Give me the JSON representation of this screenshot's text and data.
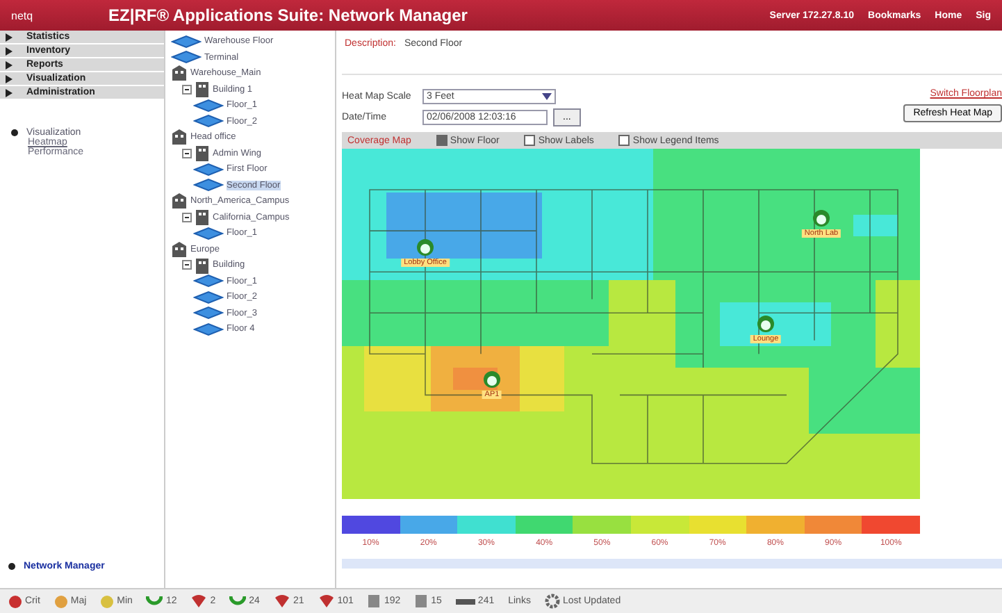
{
  "header": {
    "logo": "netq",
    "title": "EZ|RF® Applications Suite: Network Manager",
    "links": [
      "Server 172.27.8.10",
      "Bookmarks",
      "Home",
      "Sig"
    ]
  },
  "nav": {
    "menu": [
      "Statistics",
      "Inventory",
      "Reports",
      "Visualization",
      "Administration"
    ],
    "section": "Visualization",
    "sub_items": [
      {
        "label": "Heatmap",
        "selected": true
      },
      {
        "label": "Performance",
        "selected": false
      }
    ],
    "bottom_link": "Network Manager"
  },
  "tree": [
    {
      "label": "Warehouse Floor",
      "kind": "floor",
      "selected": false
    },
    {
      "label": "Terminal",
      "kind": "floor",
      "selected": false
    },
    {
      "label": "Warehouse_Main",
      "kind": "site",
      "children": [
        {
          "label": "Building 1",
          "kind": "building",
          "expanded": true,
          "children": [
            {
              "label": "Floor_1",
              "kind": "floor",
              "selected": false
            },
            {
              "label": "Floor_2",
              "kind": "floor",
              "selected": false
            }
          ]
        }
      ]
    },
    {
      "label": "Head office",
      "kind": "site",
      "children": [
        {
          "label": "Admin Wing",
          "kind": "building",
          "expanded": true,
          "children": [
            {
              "label": "First Floor",
              "kind": "floor",
              "selected": false
            },
            {
              "label": "Second Floor",
              "kind": "floor",
              "selected": true
            }
          ]
        }
      ]
    },
    {
      "label": "North_America_Campus",
      "kind": "site",
      "children": [
        {
          "label": "California_Campus",
          "kind": "building",
          "expanded": true,
          "children": [
            {
              "label": "Floor_1",
              "kind": "floor",
              "selected": false
            }
          ]
        }
      ]
    },
    {
      "label": "Europe",
      "kind": "site",
      "children": [
        {
          "label": "Building",
          "kind": "building",
          "expanded": true,
          "children": [
            {
              "label": "Floor_1",
              "kind": "floor",
              "selected": false
            },
            {
              "label": "Floor_2",
              "kind": "floor",
              "selected": false
            },
            {
              "label": "Floor_3",
              "kind": "floor",
              "selected": false
            },
            {
              "label": "Floor 4",
              "kind": "floor",
              "selected": false
            }
          ]
        }
      ]
    }
  ],
  "main": {
    "description_label": "Description:",
    "description_value": "Second Floor",
    "scale_label": "Heat Map Scale",
    "scale_value": "3 Feet",
    "datetime_label": "Date/Time",
    "datetime_value": "02/06/2008 12:03:16",
    "picker_button": "...",
    "switch_link": "Switch Floorplan",
    "refresh_button": "Refresh Heat Map",
    "map_title": "Coverage Map",
    "checkboxes": [
      {
        "label": "Show Floor",
        "checked": true
      },
      {
        "label": "Show Labels",
        "checked": false
      },
      {
        "label": "Show Legend Items",
        "checked": false
      }
    ],
    "access_points": [
      {
        "label": "Lobby Office"
      },
      {
        "label": "North Lab"
      },
      {
        "label": "Lounge"
      },
      {
        "label": "AP1"
      }
    ],
    "legend": [
      {
        "label": "10%",
        "color": "#5048e0"
      },
      {
        "label": "20%",
        "color": "#48a8e8"
      },
      {
        "label": "30%",
        "color": "#40e0d0"
      },
      {
        "label": "40%",
        "color": "#40d870"
      },
      {
        "label": "50%",
        "color": "#98e040"
      },
      {
        "label": "60%",
        "color": "#c8e838"
      },
      {
        "label": "70%",
        "color": "#e8e030"
      },
      {
        "label": "80%",
        "color": "#f0b030"
      },
      {
        "label": "90%",
        "color": "#f08838"
      },
      {
        "label": "100%",
        "color": "#f04830"
      }
    ]
  },
  "status_bar": [
    {
      "kind": "red",
      "text": "Crit"
    },
    {
      "kind": "amber",
      "text": "Maj"
    },
    {
      "kind": "yellow",
      "text": "Min"
    },
    {
      "kind": "up",
      "text": "12"
    },
    {
      "kind": "down",
      "text": "2"
    },
    {
      "kind": "up",
      "text": "24"
    },
    {
      "kind": "down",
      "text": "21"
    },
    {
      "kind": "down",
      "text": "101"
    },
    {
      "kind": "device",
      "text": "192"
    },
    {
      "kind": "device",
      "text": "15"
    },
    {
      "kind": "link",
      "text": "241"
    },
    {
      "kind": "plain",
      "text": "Links"
    },
    {
      "kind": "gear",
      "text": "Lost Updated"
    }
  ]
}
